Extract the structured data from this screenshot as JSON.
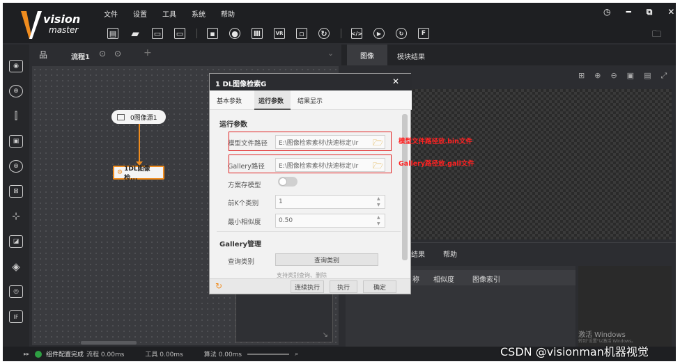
{
  "app": {
    "logo_line1": "vision",
    "logo_line2": "master"
  },
  "menu": [
    "文件",
    "设置",
    "工具",
    "系统",
    "帮助"
  ],
  "toolbar_icons": [
    "save-icon",
    "open-folder-icon",
    "save-as-icon",
    "image-icon",
    "camera-icon",
    "library-icon",
    "run-icon",
    "barcode-icon",
    "cycle-icon",
    "script-icon",
    "play-icon",
    "continuous-play-icon",
    "file-icon"
  ],
  "window_controls": {
    "help": "◷",
    "minimize": "━",
    "restore": "⧉",
    "close": "✕"
  },
  "flow": {
    "tab_label": "流程1",
    "add": "+",
    "dropdown": "⌄"
  },
  "nodes": {
    "source": "0图像源1",
    "dl": "1DL图像检..."
  },
  "right_tabs": [
    "图像",
    "模块结果"
  ],
  "result_tabs": {
    "result": "结果",
    "help": "帮助"
  },
  "result_columns": [
    "称",
    "相似度",
    "图像索引"
  ],
  "dialog": {
    "title": "1 DL图像检索G",
    "close": "✕",
    "tabs": [
      "基本参数",
      "运行参数",
      "结果显示"
    ],
    "section": "运行参数",
    "model_path_label": "模型文件路径",
    "model_path_value": "E:\\图像检索素材\\快速标定\\Ir",
    "gallery_path_label": "Gallery路径",
    "gallery_path_value": "E:\\图像检索素材\\快速标定\\Ir",
    "save_model_label": "方案存模型",
    "topk_label": "前K个类别",
    "topk_value": "1",
    "min_sim_label": "最小相似度",
    "min_sim_value": "0.50",
    "gallery_mgmt": "Gallery管理",
    "query_label": "查询类别",
    "query_button": "查询类别",
    "query_hint": "支持类别查询、删除",
    "buttons": {
      "continuous": "连续执行",
      "run": "执行",
      "ok": "确定"
    }
  },
  "annotations": {
    "model": "模型文件路径放.bin文件",
    "gallery": "Gallery路径放.gall文件"
  },
  "status": {
    "text": "组件配置完成",
    "flow": "流程 0.00ms",
    "tools": "工具 0.00ms",
    "algo": "算法 0.00ms"
  },
  "watermark": {
    "line1": "激活 Windows",
    "line2": "转到\"设置\"以激活 Windows。"
  },
  "csdn": "CSDN @visionman机器视觉",
  "colors": {
    "accent": "#f08c1e",
    "annotation": "#e02020",
    "dark": "#1e1f22"
  }
}
